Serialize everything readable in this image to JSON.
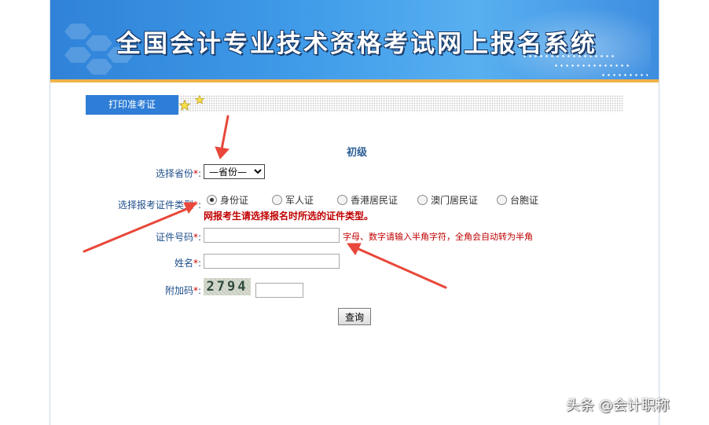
{
  "banner": {
    "title": "全国会计专业技术资格考试网上报名系统"
  },
  "tabs": {
    "print_admission": "打印准考证"
  },
  "form": {
    "level": "初级",
    "province_label": "选择省份",
    "province_value": "—省份—",
    "doc_type_label": "选择报考证件类型",
    "doc_types": [
      "身份证",
      "军人证",
      "香港居民证",
      "澳门居民证",
      "台胞证"
    ],
    "doc_type_selected": 0,
    "doc_type_warning": "网报考生请选择报名时所选的证件类型。",
    "id_label": "证件号码",
    "id_value": "",
    "id_hint": "字母、数字请输入半角字符，全角会自动转为半角",
    "name_label": "姓名",
    "name_value": "",
    "captcha_label": "附加码",
    "captcha_code": "2794",
    "captcha_value": "",
    "required_mark": "*",
    "colon": ":",
    "query_button": "查询"
  },
  "annotations": {
    "arrow_color": "#e8473a"
  },
  "watermark": "头条 @会计职称"
}
